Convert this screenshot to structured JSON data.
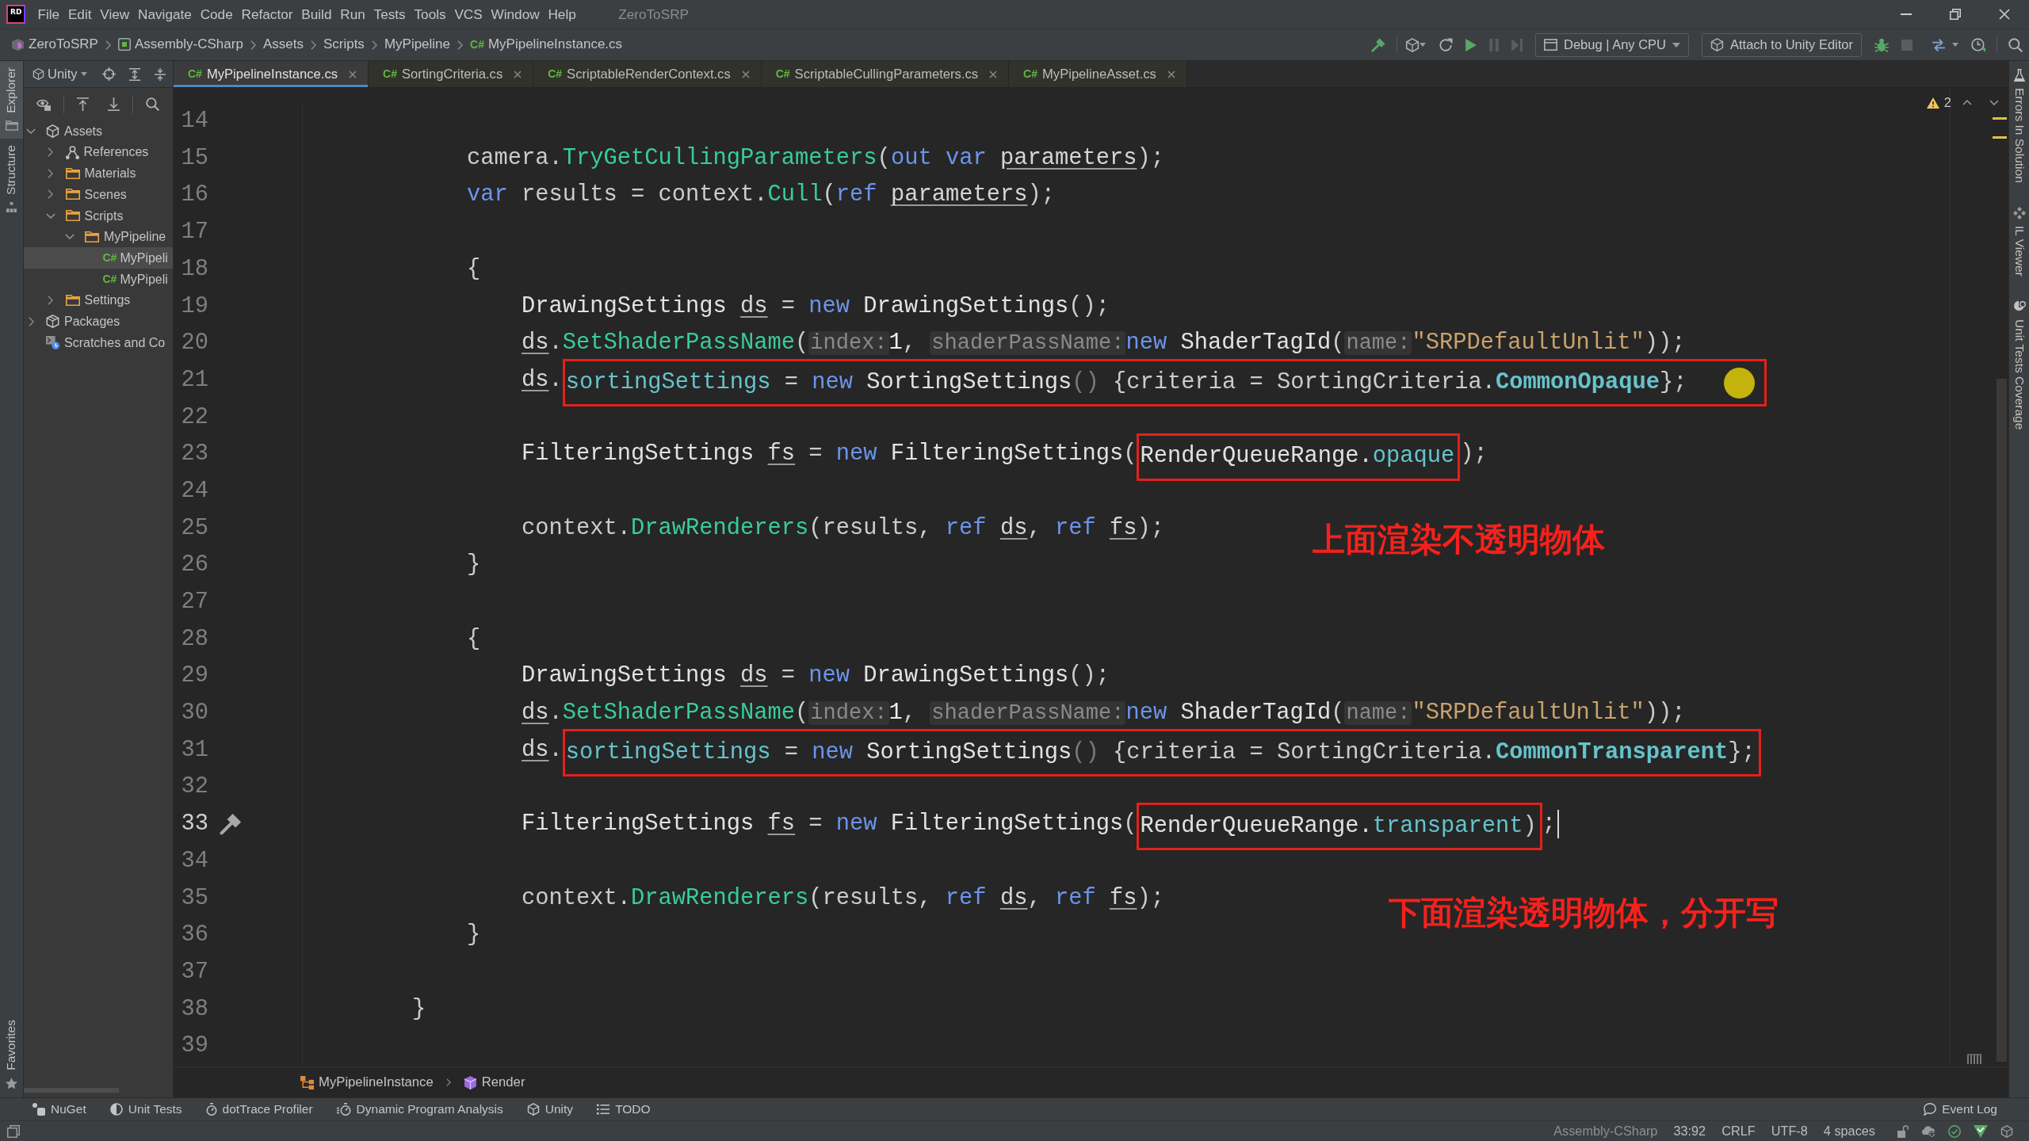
{
  "window": {
    "logo": "RD",
    "menus": [
      "File",
      "Edit",
      "View",
      "Navigate",
      "Code",
      "Refactor",
      "Build",
      "Run",
      "Tests",
      "Tools",
      "VCS",
      "Window",
      "Help"
    ],
    "title": "ZeroToSRP"
  },
  "navigation_bar": [
    {
      "label": "ZeroToSRP",
      "kind": "solution"
    },
    {
      "label": "Assembly-CSharp",
      "kind": "project"
    },
    {
      "label": "Assets",
      "kind": "folder"
    },
    {
      "label": "Scripts",
      "kind": "folder"
    },
    {
      "label": "MyPipeline",
      "kind": "folder"
    },
    {
      "label": "MyPipelineInstance.cs",
      "kind": "file",
      "type_label": "C#"
    }
  ],
  "toolbar": {
    "configuration": "Debug | Any CPU",
    "attach_button": "Attach to Unity Editor"
  },
  "left_stripe": {
    "top": [
      {
        "label": "Explorer",
        "selected": true
      },
      {
        "label": "Structure",
        "selected": false
      }
    ],
    "bottom": [
      {
        "label": "Favorites",
        "selected": false
      }
    ]
  },
  "explorer": {
    "title": "Unity",
    "tree": [
      {
        "label": "Assets",
        "kind": "unity",
        "expanded": true,
        "selected": false,
        "children": [
          {
            "label": "References",
            "kind": "references",
            "expanded": false,
            "selected": false
          },
          {
            "label": "Materials",
            "kind": "folder",
            "expanded": false,
            "selected": false
          },
          {
            "label": "Scenes",
            "kind": "folder",
            "expanded": false,
            "selected": false
          },
          {
            "label": "Scripts",
            "kind": "folder",
            "expanded": true,
            "selected": false,
            "children": [
              {
                "label": "MyPipeline",
                "kind": "folder",
                "expanded": true,
                "selected": false,
                "children": [
                  {
                    "label": "MyPipeli",
                    "kind": "file",
                    "type_label": "C#",
                    "selected": true
                  },
                  {
                    "label": "MyPipeli",
                    "kind": "file",
                    "type_label": "C#",
                    "selected": false
                  }
                ]
              }
            ]
          },
          {
            "label": "Settings",
            "kind": "folder",
            "expanded": false,
            "selected": false
          }
        ]
      },
      {
        "label": "Packages",
        "kind": "package",
        "expanded": false,
        "selected": false
      },
      {
        "label": "Scratches and Co",
        "kind": "scratches",
        "selected": false
      }
    ]
  },
  "tabs": [
    {
      "type_label": "C#",
      "label": "MyPipelineInstance.cs",
      "selected": true
    },
    {
      "type_label": "C#",
      "label": "SortingCriteria.cs",
      "selected": false
    },
    {
      "type_label": "C#",
      "label": "ScriptableRenderContext.cs",
      "selected": false
    },
    {
      "type_label": "C#",
      "label": "ScriptableCullingParameters.cs",
      "selected": false
    },
    {
      "type_label": "C#",
      "label": "MyPipelineAsset.cs",
      "selected": false
    }
  ],
  "editor": {
    "warnings": "2",
    "lines": [
      {
        "number": "14",
        "current": false
      },
      {
        "number": "15",
        "current": false,
        "segments": [
          {
            "text": "            camera.",
            "kind": "plain"
          },
          {
            "text": "TryGetCullingParameters",
            "kind": "method"
          },
          {
            "text": "(",
            "kind": "plain"
          },
          {
            "text": "out var ",
            "kind": "keyword"
          },
          {
            "text": "parameters",
            "kind": "local"
          },
          {
            "text": ");",
            "kind": "plain"
          }
        ]
      },
      {
        "number": "16",
        "current": false,
        "segments": [
          {
            "text": "            var ",
            "kind": "keyword"
          },
          {
            "text": "results = context.",
            "kind": "plain"
          },
          {
            "text": "Cull",
            "kind": "method"
          },
          {
            "text": "(",
            "kind": "plain"
          },
          {
            "text": "ref ",
            "kind": "keyword"
          },
          {
            "text": "parameters",
            "kind": "local"
          },
          {
            "text": ");",
            "kind": "plain"
          }
        ]
      },
      {
        "number": "17",
        "current": false
      },
      {
        "number": "18",
        "current": false,
        "segments": [
          {
            "text": "            {",
            "kind": "plain"
          }
        ]
      },
      {
        "number": "19",
        "current": false,
        "segments": [
          {
            "text": "                DrawingSettings ",
            "kind": "type"
          },
          {
            "text": "ds",
            "kind": "local"
          },
          {
            "text": " = ",
            "kind": "plain"
          },
          {
            "text": "new ",
            "kind": "keyword"
          },
          {
            "text": "DrawingSettings",
            "kind": "type"
          },
          {
            "text": "();",
            "kind": "plain"
          }
        ]
      },
      {
        "number": "20",
        "current": false,
        "segments": [
          {
            "text": "                ds",
            "kind": "local"
          },
          {
            "text": ".",
            "kind": "plain"
          },
          {
            "text": "SetShaderPassName",
            "kind": "method"
          },
          {
            "text": "(",
            "kind": "plain"
          },
          {
            "text": "index:",
            "kind": "hint"
          },
          {
            "text": "1",
            "kind": "number"
          },
          {
            "text": ", ",
            "kind": "plain"
          },
          {
            "text": "shaderPassName:",
            "kind": "hint"
          },
          {
            "text": "new ",
            "kind": "keyword"
          },
          {
            "text": "ShaderTagId",
            "kind": "type"
          },
          {
            "text": "(",
            "kind": "plain"
          },
          {
            "text": "name:",
            "kind": "hint"
          },
          {
            "text": "\"SRPDefaultUnlit\"",
            "kind": "string"
          },
          {
            "text": "));",
            "kind": "plain"
          }
        ]
      },
      {
        "number": "21",
        "current": false,
        "segments": [
          {
            "text": "                ds",
            "kind": "local"
          },
          {
            "text": ".",
            "kind": "plain"
          },
          {
            "kind": "frame",
            "pointer": true,
            "segments": [
              {
                "text": "sortingSettings",
                "kind": "member"
              },
              {
                "text": " = ",
                "kind": "plain"
              },
              {
                "text": "new ",
                "kind": "keyword"
              },
              {
                "text": "SortingSettings",
                "kind": "type"
              },
              {
                "text": "()",
                "kind": "dim"
              },
              {
                "text": " {criteria = SortingCriteria.",
                "kind": "plain"
              },
              {
                "text": "CommonOpaque",
                "kind": "constant"
              },
              {
                "text": "};",
                "kind": "plain"
              }
            ]
          }
        ]
      },
      {
        "number": "22",
        "current": false
      },
      {
        "number": "23",
        "current": false,
        "segments": [
          {
            "text": "                FilteringSettings ",
            "kind": "type"
          },
          {
            "text": "fs",
            "kind": "local"
          },
          {
            "text": " = ",
            "kind": "plain"
          },
          {
            "text": "new ",
            "kind": "keyword"
          },
          {
            "text": "FilteringSettings",
            "kind": "type"
          },
          {
            "text": "(",
            "kind": "plain"
          },
          {
            "kind": "frame",
            "pointer": false,
            "segments": [
              {
                "text": "RenderQueueRange.",
                "kind": "type"
              },
              {
                "text": "opaque",
                "kind": "member"
              }
            ]
          },
          {
            "text": ");",
            "kind": "plain"
          }
        ]
      },
      {
        "number": "24",
        "current": false
      },
      {
        "number": "25",
        "current": false,
        "note": "上面渲染不透明物体",
        "segments": [
          {
            "text": "                context.",
            "kind": "plain"
          },
          {
            "text": "DrawRenderers",
            "kind": "method"
          },
          {
            "text": "(results, ",
            "kind": "plain"
          },
          {
            "text": "ref ",
            "kind": "keyword"
          },
          {
            "text": "ds",
            "kind": "local"
          },
          {
            "text": ", ",
            "kind": "plain"
          },
          {
            "text": "ref ",
            "kind": "keyword"
          },
          {
            "text": "fs",
            "kind": "local"
          },
          {
            "text": ");",
            "kind": "plain"
          }
        ]
      },
      {
        "number": "26",
        "current": false,
        "segments": [
          {
            "text": "            }",
            "kind": "plain"
          }
        ]
      },
      {
        "number": "27",
        "current": false
      },
      {
        "number": "28",
        "current": false,
        "segments": [
          {
            "text": "            {",
            "kind": "plain"
          }
        ]
      },
      {
        "number": "29",
        "current": false,
        "segments": [
          {
            "text": "                DrawingSettings ",
            "kind": "type"
          },
          {
            "text": "ds",
            "kind": "local"
          },
          {
            "text": " = ",
            "kind": "plain"
          },
          {
            "text": "new ",
            "kind": "keyword"
          },
          {
            "text": "DrawingSettings",
            "kind": "type"
          },
          {
            "text": "();",
            "kind": "plain"
          }
        ]
      },
      {
        "number": "30",
        "current": false,
        "segments": [
          {
            "text": "                ds",
            "kind": "local"
          },
          {
            "text": ".",
            "kind": "plain"
          },
          {
            "text": "SetShaderPassName",
            "kind": "method"
          },
          {
            "text": "(",
            "kind": "plain"
          },
          {
            "text": "index:",
            "kind": "hint"
          },
          {
            "text": "1",
            "kind": "number"
          },
          {
            "text": ", ",
            "kind": "plain"
          },
          {
            "text": "shaderPassName:",
            "kind": "hint"
          },
          {
            "text": "new ",
            "kind": "keyword"
          },
          {
            "text": "ShaderTagId",
            "kind": "type"
          },
          {
            "text": "(",
            "kind": "plain"
          },
          {
            "text": "name:",
            "kind": "hint"
          },
          {
            "text": "\"SRPDefaultUnlit\"",
            "kind": "string"
          },
          {
            "text": "));",
            "kind": "plain"
          }
        ]
      },
      {
        "number": "31",
        "current": false,
        "segments": [
          {
            "text": "                ds",
            "kind": "local"
          },
          {
            "text": ".",
            "kind": "plain"
          },
          {
            "kind": "frame",
            "pointer": false,
            "segments": [
              {
                "text": "sortingSettings",
                "kind": "member"
              },
              {
                "text": " = ",
                "kind": "plain"
              },
              {
                "text": "new ",
                "kind": "keyword"
              },
              {
                "text": "SortingSettings",
                "kind": "type"
              },
              {
                "text": "()",
                "kind": "dim"
              },
              {
                "text": " {criteria = SortingCriteria.",
                "kind": "plain"
              },
              {
                "text": "CommonTransparent",
                "kind": "constant"
              },
              {
                "text": "};",
                "kind": "plain"
              }
            ]
          }
        ]
      },
      {
        "number": "32",
        "current": false
      },
      {
        "number": "33",
        "current": true,
        "segments": [
          {
            "text": "                FilteringSettings ",
            "kind": "type"
          },
          {
            "text": "fs",
            "kind": "local"
          },
          {
            "text": " = ",
            "kind": "plain"
          },
          {
            "text": "new ",
            "kind": "keyword"
          },
          {
            "text": "FilteringSettings",
            "kind": "type"
          },
          {
            "text": "(",
            "kind": "plain"
          },
          {
            "kind": "frame",
            "pointer": false,
            "segments": [
              {
                "text": "RenderQueueRange.",
                "kind": "type"
              },
              {
                "text": "transparent",
                "kind": "member"
              },
              {
                "text": ")",
                "kind": "plain"
              }
            ]
          },
          {
            "text": ";",
            "kind": "plain"
          }
        ]
      },
      {
        "number": "34",
        "current": false
      },
      {
        "number": "35",
        "current": false,
        "note": "下面渲染透明物体，分开写",
        "segments": [
          {
            "text": "                context.",
            "kind": "plain"
          },
          {
            "text": "DrawRenderers",
            "kind": "method"
          },
          {
            "text": "(results, ",
            "kind": "plain"
          },
          {
            "text": "ref ",
            "kind": "keyword"
          },
          {
            "text": "ds",
            "kind": "local"
          },
          {
            "text": ", ",
            "kind": "plain"
          },
          {
            "text": "ref ",
            "kind": "keyword"
          },
          {
            "text": "fs",
            "kind": "local"
          },
          {
            "text": ");",
            "kind": "plain"
          }
        ]
      },
      {
        "number": "36",
        "current": false,
        "segments": [
          {
            "text": "            }",
            "kind": "plain"
          }
        ]
      },
      {
        "number": "37",
        "current": false
      },
      {
        "number": "38",
        "current": false,
        "segments": [
          {
            "text": "        }",
            "kind": "plain"
          }
        ]
      },
      {
        "number": "39",
        "current": false
      }
    ]
  },
  "editor_breadcrumb": [
    {
      "label": "MyPipelineInstance",
      "kind": "class"
    },
    {
      "label": "Render",
      "kind": "method"
    }
  ],
  "right_stripe": [
    "Errors In Solution",
    "IL Viewer",
    "Unit Tests Coverage"
  ],
  "tool_windows": [
    "NuGet",
    "Unit Tests",
    "dotTrace Profiler",
    "Dynamic Program Analysis",
    "Unity",
    "TODO"
  ],
  "event_log": "Event Log",
  "status_bar": {
    "project": "Assembly-CSharp",
    "position": "33:92",
    "line_separator": "CRLF",
    "encoding": "UTF-8",
    "indent": "4 spaces"
  }
}
